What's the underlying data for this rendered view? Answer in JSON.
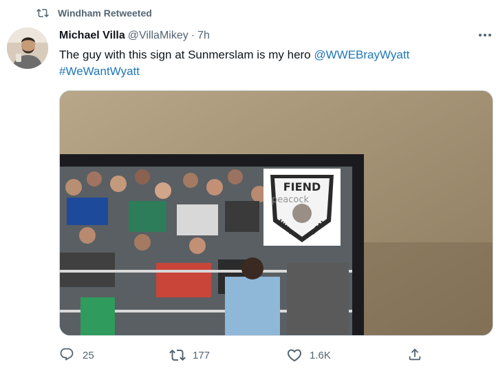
{
  "retweet": {
    "label": "Windham Retweeted",
    "icon": "retweet-icon"
  },
  "author": {
    "name": "Michael Villa",
    "handle": "@VillaMikey",
    "separator": "·",
    "time": "7h"
  },
  "tweet": {
    "text_before": "The guy with this sign at Sunmerslam is my hero ",
    "mention": "@WWEBrayWyatt",
    "hashtag": "#WeWantWyatt"
  },
  "media": {
    "sign_title": "FIEND",
    "sign_brand": "peacock",
    "sign_left": "HURT",
    "sign_right": "HEAL"
  },
  "actions": {
    "reply": {
      "icon": "reply-icon",
      "count": "25"
    },
    "retweet": {
      "icon": "retweet-icon",
      "count": "177"
    },
    "like": {
      "icon": "heart-icon",
      "count": "1.6K"
    },
    "share": {
      "icon": "share-icon"
    }
  },
  "colors": {
    "link": "#1d9bf0",
    "muted": "#536471",
    "text": "#0f1419"
  }
}
